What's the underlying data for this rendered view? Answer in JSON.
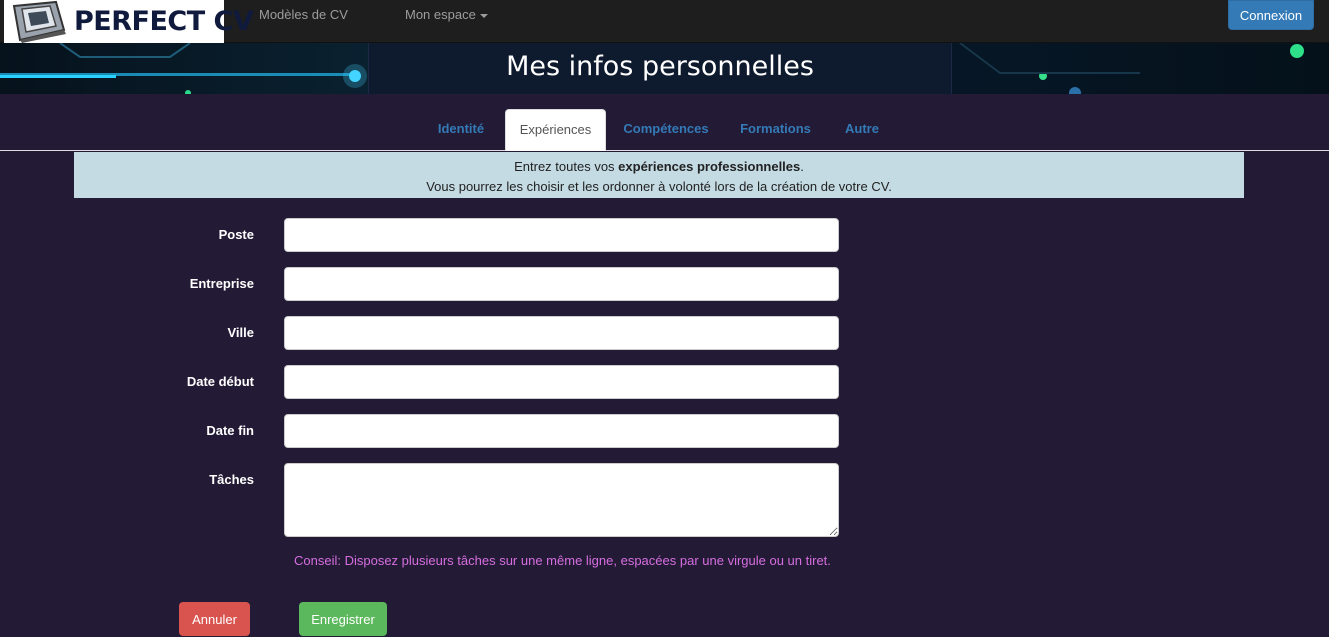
{
  "navbar": {
    "brand": "PERFECT CV",
    "links": [
      "Modèles de CV",
      "Mon espace"
    ],
    "login_button": "Connexion"
  },
  "banner": {
    "title": "Mes infos personnelles"
  },
  "tabs": [
    {
      "label": "Identité",
      "active": false
    },
    {
      "label": "Expériences",
      "active": true
    },
    {
      "label": "Compétences",
      "active": false
    },
    {
      "label": "Formations",
      "active": false
    },
    {
      "label": "Autre",
      "active": false
    }
  ],
  "info": {
    "line1_before": "Entrez toutes vos ",
    "line1_bold": "expériences professionnelles",
    "line1_after": ".",
    "line2": "Vous pourrez les choisir et les ordonner à volonté lors de la création de votre CV."
  },
  "form": {
    "fields": [
      {
        "label": "Poste",
        "value": ""
      },
      {
        "label": "Entreprise",
        "value": ""
      },
      {
        "label": "Ville",
        "value": ""
      },
      {
        "label": "Date début",
        "value": ""
      },
      {
        "label": "Date fin",
        "value": ""
      },
      {
        "label": "Tâches",
        "value": ""
      }
    ],
    "hint": "Conseil: Disposez plusieurs tâches sur une même ligne, espacées par une virgule ou un tiret.",
    "cancel_button": "Annuler",
    "save_button": "Enregistrer"
  },
  "colors": {
    "background": "#231a35",
    "primary": "#337ab7",
    "danger": "#d9534f",
    "success": "#5cb85c",
    "hint": "#d66ee0",
    "info_bg": "#c4dbe4"
  }
}
